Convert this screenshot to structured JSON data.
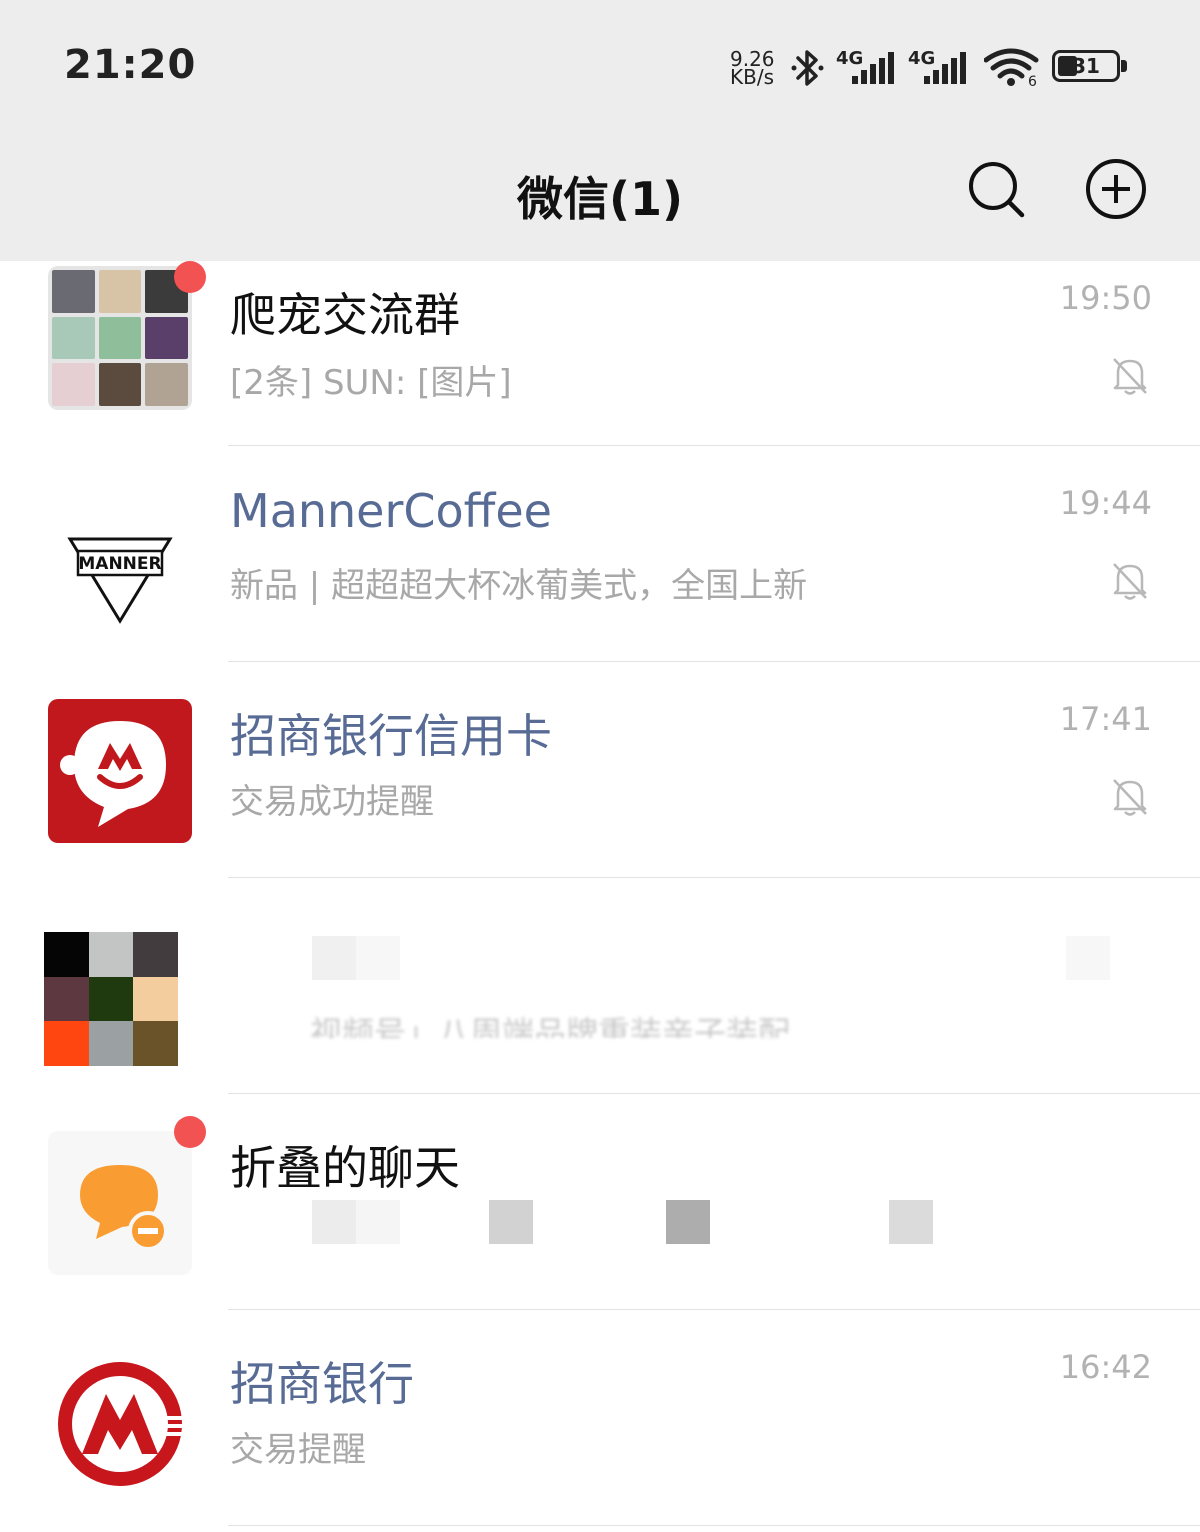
{
  "status_bar": {
    "time": "21:20",
    "net_speed_value": "9.26",
    "net_speed_unit": "KB/s",
    "signal_1_label": "4G",
    "signal_2_label": "4G",
    "wifi_badge": "6",
    "battery_level": "31"
  },
  "header": {
    "title": "微信(1)"
  },
  "chats": [
    {
      "name": "爬宠交流群",
      "message": "[2条] SUN: [图片]",
      "time": "19:50",
      "muted": true,
      "unread_dot": true
    },
    {
      "name": "MannerCoffee",
      "avatar_text": "MANNER",
      "message": "新品 | 超超超大杯冰葡美式，全国上新",
      "time": "19:44",
      "muted": true,
      "official": true
    },
    {
      "name": "招商银行信用卡",
      "message": "交易成功提醒",
      "time": "17:41",
      "muted": true,
      "official": true
    },
    {
      "name": "",
      "message": "视频号」八周端品牌重装亲子装配",
      "time": "",
      "muted": true,
      "obscured": true
    },
    {
      "name": "折叠的聊天",
      "message": "",
      "time": "",
      "unread_dot": true
    },
    {
      "name": "招商银行",
      "message": "交易提醒",
      "time": "16:42",
      "official": true
    }
  ],
  "colors": {
    "header_bg": "#ededed",
    "official_name": "#576b95",
    "unread_dot": "#f25252",
    "cmb_red": "#c0181c",
    "folded_orange": "#f99d32"
  }
}
